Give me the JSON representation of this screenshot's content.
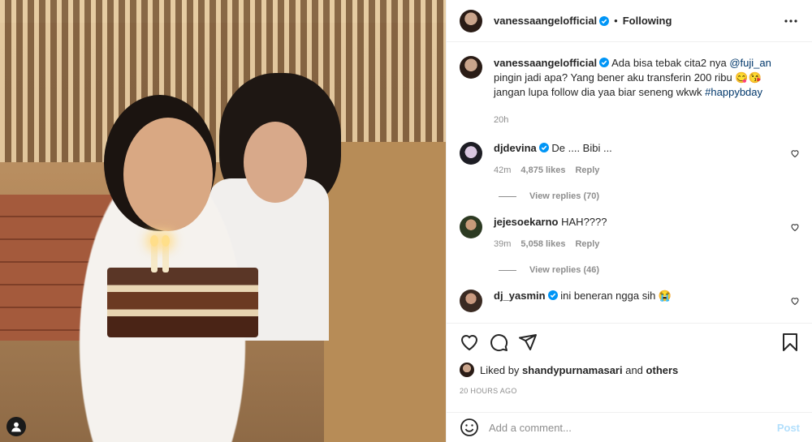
{
  "post": {
    "author": "vanessaangelofficial",
    "follow_status": "Following",
    "separator": "•",
    "caption": {
      "text_1": "Ada bisa tebak cita2 nya ",
      "mention": "@fuji_an",
      "text_2": " pingin jadi apa? Yang bener aku transferin 200 ribu 😋😘 jangan lupa follow dia yaa biar seneng wkwk ",
      "hashtag": "#happybday",
      "age": "20h"
    }
  },
  "comments": [
    {
      "user": "djdevina",
      "text": "De .... Bibi ...",
      "age": "42m",
      "likes": "4,875 likes",
      "reply": "Reply",
      "view_replies": "View replies (70)"
    },
    {
      "user": "jejesoekarno",
      "text": "HAH????",
      "age": "39m",
      "likes": "5,058 likes",
      "reply": "Reply",
      "view_replies": "View replies (46)"
    },
    {
      "user": "dj_yasmin",
      "text": "ini beneran ngga sih 😭"
    }
  ],
  "liked_by": {
    "prefix": "Liked by ",
    "user": "shandypurnamasari",
    "suffix": " and ",
    "others": "others"
  },
  "timestamp": "20 HOURS AGO",
  "add_comment": {
    "placeholder": "Add a comment...",
    "post": "Post"
  },
  "icons": {
    "more": "more-options-icon",
    "verified": "verified-badge-icon",
    "like": "heart-icon",
    "comment": "comment-icon",
    "share": "share-icon",
    "save": "bookmark-icon",
    "emoji": "emoji-icon",
    "photo_user": "user-tag-icon"
  },
  "colors": {
    "verified": "#0095f6",
    "link": "#00376b",
    "post_disabled": "#b2dffc"
  }
}
